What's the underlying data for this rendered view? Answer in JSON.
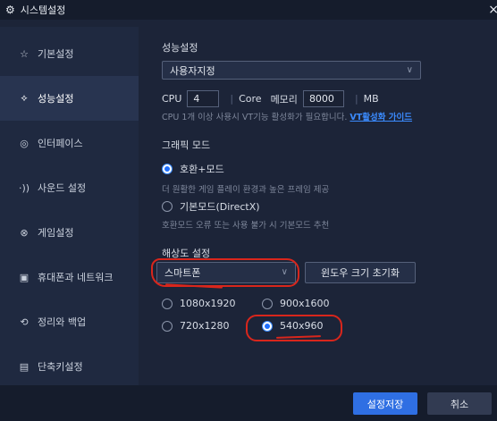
{
  "window": {
    "title": "시스템설정",
    "close_glyph": "×"
  },
  "sidebar": {
    "items": [
      {
        "label": "기본설정",
        "icon": "star-outline-icon",
        "glyph": "☆"
      },
      {
        "label": "성능설정",
        "icon": "performance-icon",
        "glyph": "⟡"
      },
      {
        "label": "인터페이스",
        "icon": "interface-icon",
        "glyph": "◎"
      },
      {
        "label": "사운드 설정",
        "icon": "sound-icon",
        "glyph": "·))"
      },
      {
        "label": "게임설정",
        "icon": "game-settings-icon",
        "glyph": "⊗"
      },
      {
        "label": "휴대폰과 네트워크",
        "icon": "phone-network-icon",
        "glyph": "▣"
      },
      {
        "label": "정리와 백업",
        "icon": "cleanup-backup-icon",
        "glyph": "⟲"
      },
      {
        "label": "단축키설정",
        "icon": "keyboard-icon",
        "glyph": "▤"
      }
    ],
    "active_index": 1
  },
  "performance": {
    "section_title": "성능설정",
    "preset": {
      "selected": "사용자지정"
    },
    "cpu_label": "CPU",
    "cpu_value": "4",
    "core_label": "Core",
    "memory_label": "메모리",
    "memory_value": "8000",
    "memory_unit": "MB",
    "vt_note": "CPU 1개 이상 사용시 VT기능 활성화가 필요합니다.",
    "vt_link": "VT활성화 가이드"
  },
  "graphics": {
    "section_title": "그래픽 모드",
    "options": [
      {
        "label": "호환+모드",
        "desc": "더 원활한 게임 플레이 환경과 높은 프레임 제공",
        "selected": true
      },
      {
        "label": "기본모드(DirectX)",
        "desc": "호환모드 오류 또는 사용 불가 시 기본모드 추천",
        "selected": false
      }
    ]
  },
  "resolution": {
    "section_title": "해상도 설정",
    "device": {
      "selected": "스마트폰"
    },
    "reset_button": "윈도우 크기 초기화",
    "options": [
      {
        "label": "1080x1920",
        "selected": false
      },
      {
        "label": "900x1600",
        "selected": false
      },
      {
        "label": "720x1280",
        "selected": false
      },
      {
        "label": "540x960",
        "selected": true
      }
    ]
  },
  "footer": {
    "save_button": "설정저장",
    "cancel_button": "취소"
  },
  "colors": {
    "accent": "#2f6fe3",
    "link": "#3b8bff",
    "annotation": "#d9261c",
    "background": "#1c2438"
  }
}
